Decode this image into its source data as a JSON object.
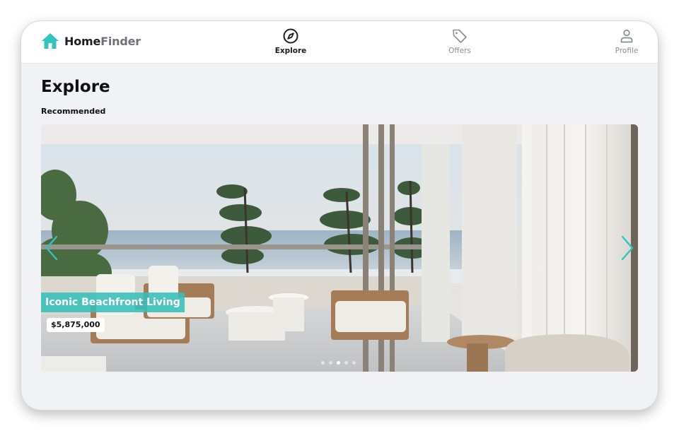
{
  "app": {
    "name_part1": "Home",
    "name_part2": "Finder",
    "accent": "#2ec4c0"
  },
  "nav": {
    "items": [
      {
        "label": "Explore",
        "icon": "compass-icon",
        "active": true
      },
      {
        "label": "Offers",
        "icon": "tag-icon",
        "active": false
      },
      {
        "label": "Profile",
        "icon": "user-icon",
        "active": false
      }
    ]
  },
  "main": {
    "title": "Explore",
    "section": "Recommended",
    "carousel": {
      "listing_title": "Iconic Beachfront Living",
      "price": "$5,875,000",
      "slide_count": 5,
      "active_slide": 3
    }
  }
}
